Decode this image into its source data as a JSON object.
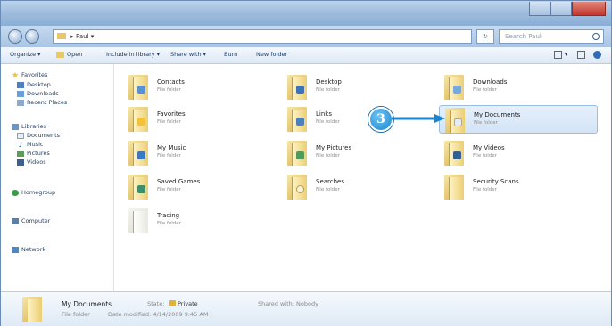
{
  "window": {
    "title": ""
  },
  "address": {
    "path": "Paul",
    "separator": "▸",
    "search_placeholder": "Search Paul"
  },
  "toolbar": {
    "organize": "Organize ▾",
    "open": "Open",
    "include": "Include in library ▾",
    "share": "Share with ▾",
    "burn": "Burn",
    "new_folder": "New folder"
  },
  "nav": {
    "favorites": "Favorites",
    "desktop": "Desktop",
    "downloads": "Downloads",
    "recent": "Recent Places",
    "libraries": "Libraries",
    "documents": "Documents",
    "music": "Music",
    "pictures": "Pictures",
    "videos": "Videos",
    "homegroup": "Homegroup",
    "computer": "Computer",
    "network": "Network"
  },
  "items": [
    {
      "name": "Contacts",
      "sub": "File folder"
    },
    {
      "name": "Desktop",
      "sub": "File folder"
    },
    {
      "name": "Downloads",
      "sub": "File folder"
    },
    {
      "name": "Favorites",
      "sub": "File folder"
    },
    {
      "name": "Links",
      "sub": "File folder"
    },
    {
      "name": "My Documents",
      "sub": "File folder"
    },
    {
      "name": "My Music",
      "sub": "File folder"
    },
    {
      "name": "My Pictures",
      "sub": "File folder"
    },
    {
      "name": "My Videos",
      "sub": "File folder"
    },
    {
      "name": "Saved Games",
      "sub": "File folder"
    },
    {
      "name": "Searches",
      "sub": "File folder"
    },
    {
      "name": "Security Scans",
      "sub": "File folder"
    },
    {
      "name": "Tracing",
      "sub": "File folder"
    }
  ],
  "callout": {
    "number": "3"
  },
  "details": {
    "name": "My Documents",
    "type": "File folder",
    "state_label": "State:",
    "state_value": "Private",
    "modified": "Date modified: 4/14/2009 9:45 AM",
    "shared": "Shared with: Nobody"
  }
}
